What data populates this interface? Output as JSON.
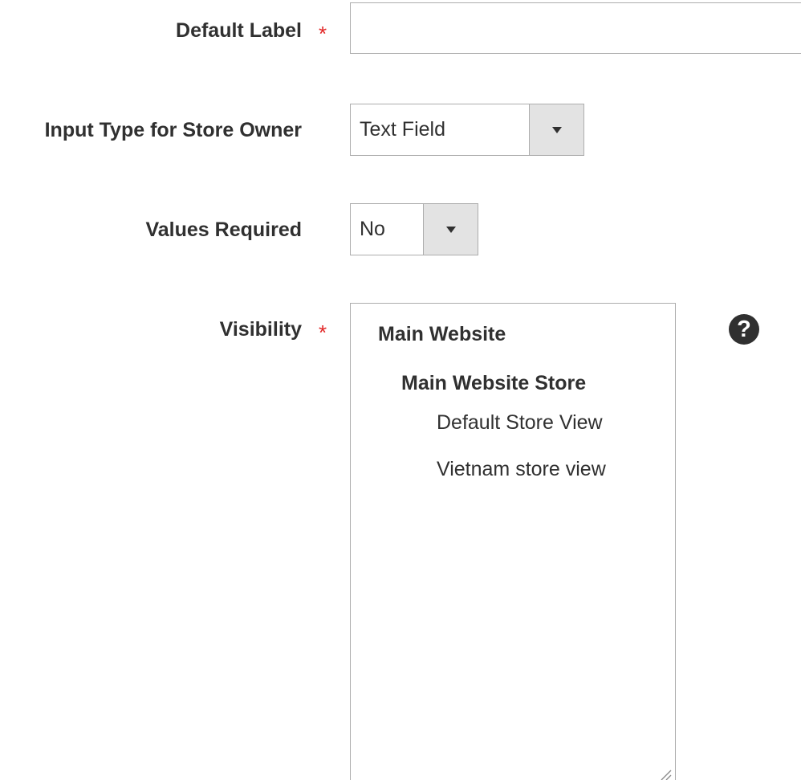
{
  "fields": {
    "default_label": {
      "label": "Default Label",
      "required_mark": "*",
      "value": "",
      "placeholder": ""
    },
    "input_type": {
      "label": "Input Type for Store Owner",
      "selected": "Text Field"
    },
    "values_required": {
      "label": "Values Required",
      "selected": "No"
    },
    "visibility": {
      "label": "Visibility",
      "required_mark": "*",
      "website": "Main Website",
      "store": "Main Website Store",
      "store_views": [
        "Default Store View",
        "Vietnam store view"
      ],
      "help_icon_glyph": "?"
    }
  },
  "icons": {
    "dropdown_arrow": "caret-down-icon",
    "help": "question-circle-icon",
    "resize": "resize-grip-icon"
  },
  "colors": {
    "required_star": "#e22626",
    "label_text": "#303030",
    "input_border": "#adadad",
    "select_arrow_bg": "#e3e3e3",
    "help_icon_bg": "#303030"
  }
}
